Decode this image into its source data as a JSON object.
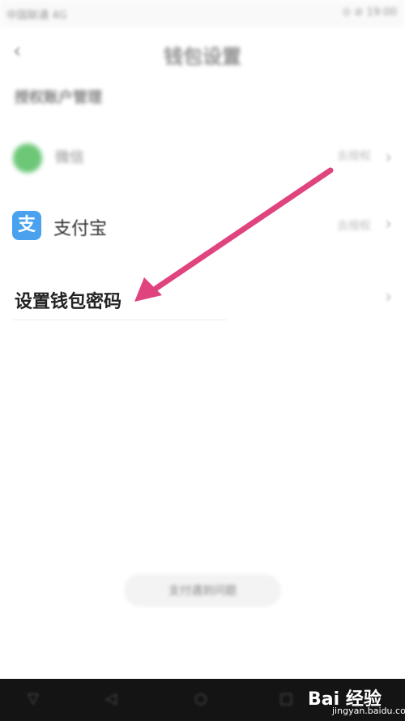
{
  "status_bar": {
    "left": "中国联通 4G",
    "right": "⊙ ⊘ 19:00"
  },
  "nav": {
    "back_icon": "back-arrow-icon",
    "title": "钱包设置"
  },
  "section": {
    "header": "授权账户管理"
  },
  "rows": {
    "wechat": {
      "label": "微信",
      "status": "去授权"
    },
    "alipay": {
      "icon_glyph": "支",
      "label": "支付宝",
      "status": "去授权"
    },
    "password": {
      "label": "设置钱包密码"
    },
    "chevron": "›"
  },
  "bottom_pill": {
    "label": "支付遇到问题"
  },
  "system_nav": {
    "back": "◁",
    "home": "○",
    "recent": "□",
    "menu": "▽"
  },
  "watermark": {
    "text": "Bai 经验",
    "url": "jingyan.baidu.com"
  },
  "annotation": {
    "arrow_color": "#e0447e"
  }
}
